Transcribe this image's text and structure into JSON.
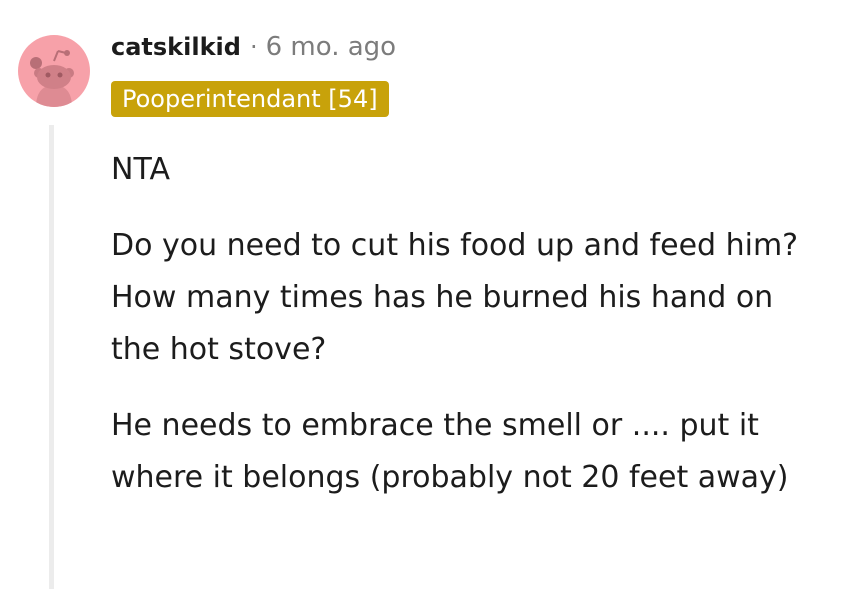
{
  "comment": {
    "author": "catskilkid",
    "separator": "·",
    "timestamp": "6 mo. ago",
    "flair": "Pooperintendant [54]",
    "paragraphs": [
      "NTA",
      "Do you need to cut his food up and feed him? How many times has he burned his hand on the hot stove?",
      "He needs to embrace the smell or .... put it where it belongs (probably not 20 feet away)"
    ]
  },
  "colors": {
    "avatar_bg": "#f7a1a9",
    "flair_bg": "#c8a20a",
    "thread_line": "#ececec",
    "meta_text": "#7c7c7c"
  },
  "icons": {
    "avatar": "reddit-snoo-avatar-icon"
  }
}
